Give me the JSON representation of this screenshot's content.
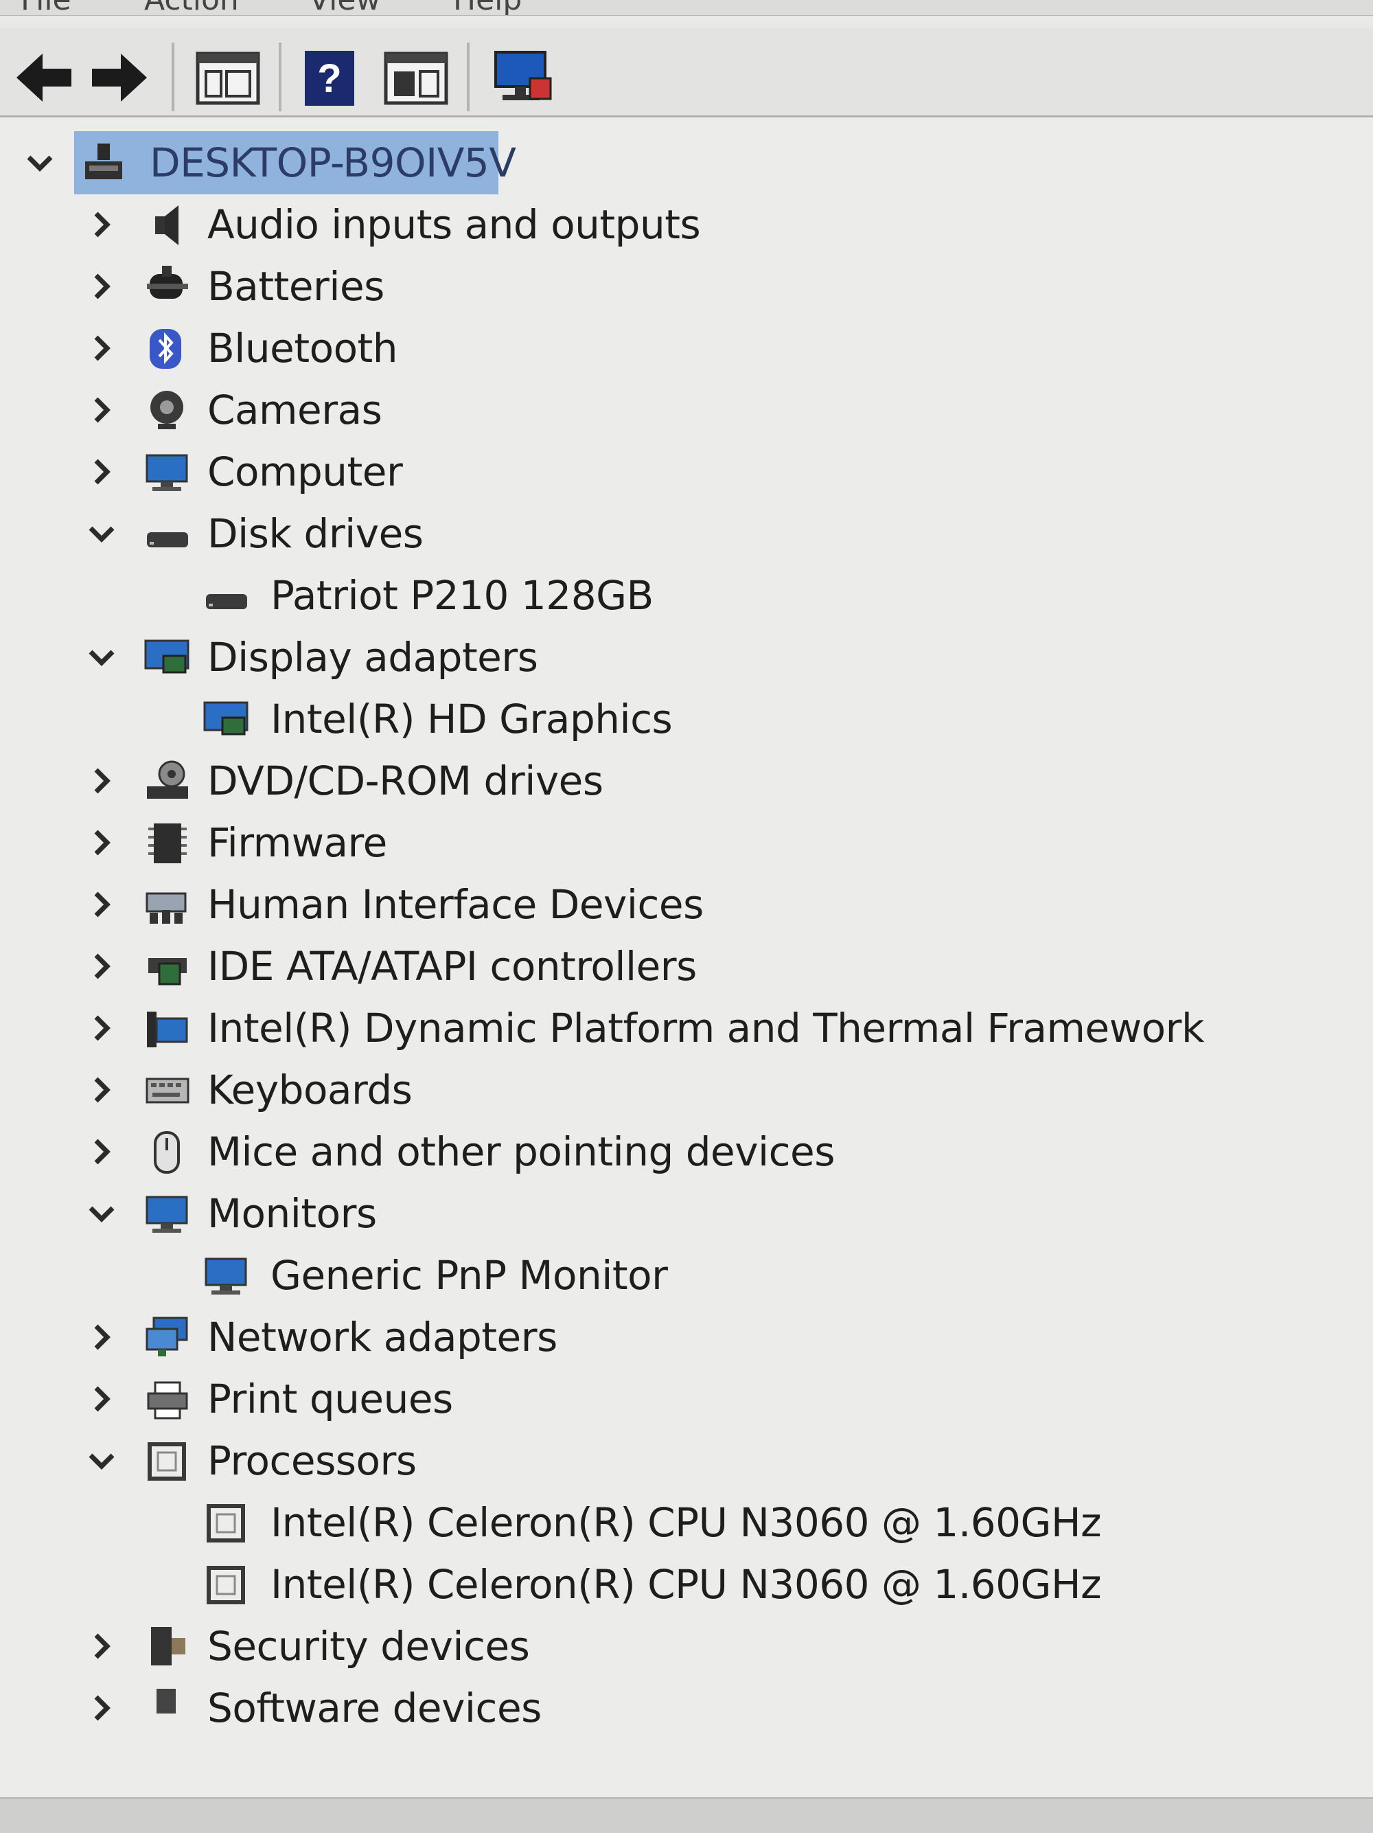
{
  "menu": {
    "items": [
      "File",
      "Action",
      "View",
      "Help"
    ]
  },
  "toolbar": {
    "buttons": [
      "back-arrow-icon",
      "forward-arrow-icon",
      "properties-icon",
      "help-icon",
      "action-pane-icon",
      "monitor-scan-icon"
    ]
  },
  "tree": {
    "root": {
      "label": "DESKTOP-B9OIV5V",
      "icon": "computer-icon",
      "expanded": true
    },
    "nodes": [
      {
        "label": "Audio inputs and outputs",
        "icon": "speaker-icon",
        "expanded": false
      },
      {
        "label": "Batteries",
        "icon": "battery-icon",
        "expanded": false
      },
      {
        "label": "Bluetooth",
        "icon": "bluetooth-icon",
        "expanded": false
      },
      {
        "label": "Cameras",
        "icon": "camera-icon",
        "expanded": false
      },
      {
        "label": "Computer",
        "icon": "monitor-icon",
        "expanded": false
      },
      {
        "label": "Disk drives",
        "icon": "disk-drive-icon",
        "expanded": true,
        "children": [
          {
            "label": "Patriot P210 128GB",
            "icon": "disk-drive-icon"
          }
        ]
      },
      {
        "label": "Display adapters",
        "icon": "display-adapter-icon",
        "expanded": true,
        "children": [
          {
            "label": "Intel(R) HD Graphics",
            "icon": "display-adapter-icon"
          }
        ]
      },
      {
        "label": "DVD/CD-ROM drives",
        "icon": "dvd-drive-icon",
        "expanded": false
      },
      {
        "label": "Firmware",
        "icon": "firmware-chip-icon",
        "expanded": false
      },
      {
        "label": "Human Interface Devices",
        "icon": "hid-icon",
        "expanded": false
      },
      {
        "label": "IDE ATA/ATAPI controllers",
        "icon": "ide-controller-icon",
        "expanded": false
      },
      {
        "label": "Intel(R) Dynamic Platform and Thermal Framework",
        "icon": "system-device-icon",
        "expanded": false
      },
      {
        "label": "Keyboards",
        "icon": "keyboard-icon",
        "expanded": false
      },
      {
        "label": "Mice and other pointing devices",
        "icon": "mouse-icon",
        "expanded": false
      },
      {
        "label": "Monitors",
        "icon": "monitor-icon",
        "expanded": true,
        "children": [
          {
            "label": "Generic PnP Monitor",
            "icon": "monitor-icon"
          }
        ]
      },
      {
        "label": "Network adapters",
        "icon": "network-adapter-icon",
        "expanded": false
      },
      {
        "label": "Print queues",
        "icon": "printer-icon",
        "expanded": false
      },
      {
        "label": "Processors",
        "icon": "processor-icon",
        "expanded": true,
        "children": [
          {
            "label": "Intel(R) Celeron(R) CPU  N3060  @ 1.60GHz",
            "icon": "processor-icon"
          },
          {
            "label": "Intel(R) Celeron(R) CPU  N3060  @ 1.60GHz",
            "icon": "processor-icon"
          }
        ]
      },
      {
        "label": "Security devices",
        "icon": "security-device-icon",
        "expanded": false
      },
      {
        "label": "Software devices",
        "icon": "software-device-icon",
        "expanded": false
      }
    ]
  },
  "colors": {
    "background": "#ececea",
    "selection": "#8fb3dd",
    "root_text": "#2b3d66",
    "text": "#1e1e1e",
    "monitor_blue": "#2a6fc4",
    "bluetooth_blue": "#3a57c7"
  }
}
